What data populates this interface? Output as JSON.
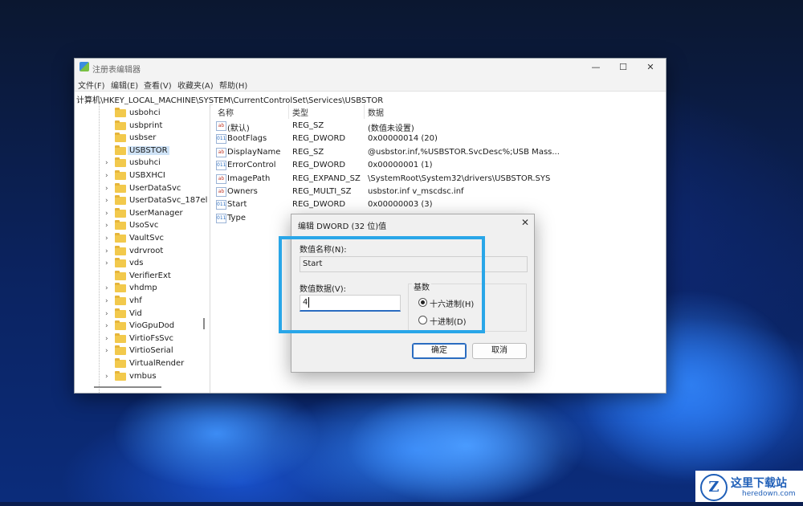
{
  "window": {
    "title": "注册表编辑器",
    "controls": {
      "minimize": "—",
      "maximize": "☐",
      "close": "✕"
    }
  },
  "menu": [
    "文件(F)",
    "编辑(E)",
    "查看(V)",
    "收藏夹(A)",
    "帮助(H)"
  ],
  "address": "计算机\\HKEY_LOCAL_MACHINE\\SYSTEM\\CurrentControlSet\\Services\\USBSTOR",
  "tree": {
    "items": [
      {
        "label": "usbohci",
        "expandable": false,
        "selected": false
      },
      {
        "label": "usbprint",
        "expandable": false,
        "selected": false
      },
      {
        "label": "usbser",
        "expandable": false,
        "selected": false
      },
      {
        "label": "USBSTOR",
        "expandable": false,
        "selected": true
      },
      {
        "label": "usbuhci",
        "expandable": true,
        "selected": false
      },
      {
        "label": "USBXHCI",
        "expandable": true,
        "selected": false
      },
      {
        "label": "UserDataSvc",
        "expandable": true,
        "selected": false
      },
      {
        "label": "UserDataSvc_187el",
        "expandable": true,
        "selected": false
      },
      {
        "label": "UserManager",
        "expandable": true,
        "selected": false
      },
      {
        "label": "UsoSvc",
        "expandable": true,
        "selected": false
      },
      {
        "label": "VaultSvc",
        "expandable": true,
        "selected": false
      },
      {
        "label": "vdrvroot",
        "expandable": true,
        "selected": false
      },
      {
        "label": "vds",
        "expandable": true,
        "selected": false
      },
      {
        "label": "VerifierExt",
        "expandable": false,
        "selected": false
      },
      {
        "label": "vhdmp",
        "expandable": true,
        "selected": false
      },
      {
        "label": "vhf",
        "expandable": true,
        "selected": false
      },
      {
        "label": "Vid",
        "expandable": true,
        "selected": false
      },
      {
        "label": "VioGpuDod",
        "expandable": true,
        "selected": false
      },
      {
        "label": "VirtioFsSvc",
        "expandable": true,
        "selected": false
      },
      {
        "label": "VirtioSerial",
        "expandable": true,
        "selected": false
      },
      {
        "label": "VirtualRender",
        "expandable": false,
        "selected": false
      },
      {
        "label": "vmbus",
        "expandable": true,
        "selected": false
      }
    ]
  },
  "list": {
    "columns": [
      "名称",
      "类型",
      "数据"
    ],
    "rows": [
      {
        "icon": "ab",
        "name": "(默认)",
        "type": "REG_SZ",
        "data": "(数值未设置)"
      },
      {
        "icon": "011",
        "name": "BootFlags",
        "type": "REG_DWORD",
        "data": "0x00000014 (20)"
      },
      {
        "icon": "ab",
        "name": "DisplayName",
        "type": "REG_SZ",
        "data": "@usbstor.inf,%USBSTOR.SvcDesc%;USB Mass..."
      },
      {
        "icon": "011",
        "name": "ErrorControl",
        "type": "REG_DWORD",
        "data": "0x00000001 (1)"
      },
      {
        "icon": "ab",
        "name": "ImagePath",
        "type": "REG_EXPAND_SZ",
        "data": "\\SystemRoot\\System32\\drivers\\USBSTOR.SYS"
      },
      {
        "icon": "ab",
        "name": "Owners",
        "type": "REG_MULTI_SZ",
        "data": "usbstor.inf v_mscdsc.inf"
      },
      {
        "icon": "011",
        "name": "Start",
        "type": "REG_DWORD",
        "data": "0x00000003 (3)"
      },
      {
        "icon": "011",
        "name": "Type",
        "type": "",
        "data": ""
      }
    ]
  },
  "dialog": {
    "title": "编辑 DWORD (32 位)值",
    "close": "✕",
    "value_name_label": "数值名称(N):",
    "value_name": "Start",
    "value_data_label": "数值数据(V):",
    "value_data": "4",
    "base_label": "基数",
    "base_options": [
      {
        "label": "十六进制(H)",
        "checked": true
      },
      {
        "label": "十进制(D)",
        "checked": false
      }
    ],
    "ok": "确定",
    "cancel": "取消"
  },
  "watermark": {
    "logo": "Z",
    "name": "这里下载站",
    "url": "heredown.com"
  }
}
